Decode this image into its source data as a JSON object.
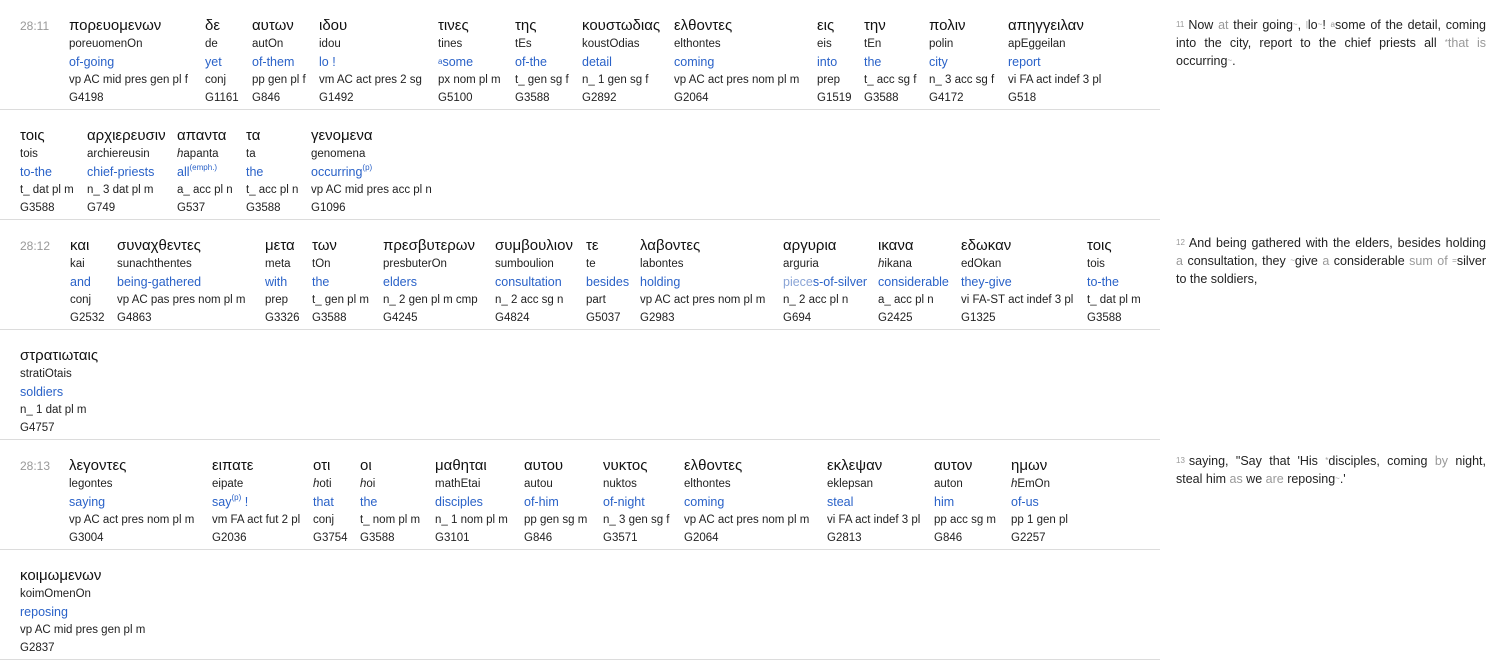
{
  "rows": [
    {
      "ref": "28:11",
      "words": [
        {
          "g": "πορευομενων",
          "tr": "poreuomenOn",
          "en": "of-going",
          "ps": "vp AC mid pres gen pl f",
          "sn": "G4198"
        },
        {
          "g": "δε",
          "tr": "de",
          "en": "yet",
          "ps": "conj",
          "sn": "G1161"
        },
        {
          "g": "αυτων",
          "tr": "autOn",
          "en": "of-them",
          "ps": "pp gen pl f",
          "sn": "G846"
        },
        {
          "g": "ιδου",
          "tr": "idou",
          "en": "lo !",
          "ps": "vm AC act pres 2 sg",
          "sn": "G1492"
        },
        {
          "g": "τινες",
          "tr": "tines",
          "en_pre": "a",
          "en": "some",
          "ps": "px nom pl m",
          "sn": "G5100"
        },
        {
          "g": "της",
          "tr": "tEs",
          "en": "of-the",
          "ps": "t_ gen sg f",
          "sn": "G3588"
        },
        {
          "g": "κουστωδιας",
          "tr": "koustOdias",
          "en": "detail",
          "ps": "n_ 1 gen sg f",
          "sn": "G2892"
        },
        {
          "g": "ελθοντες",
          "tr": "elthontes",
          "en": "coming",
          "ps": "vp AC act pres nom pl m",
          "sn": "G2064"
        },
        {
          "g": "εις",
          "tr": "eis",
          "en": "into",
          "ps": "prep",
          "sn": "G1519"
        },
        {
          "g": "την",
          "tr": "tEn",
          "en": "the",
          "ps": "t_ acc sg f",
          "sn": "G3588"
        },
        {
          "g": "πολιν",
          "tr": "polin",
          "en": "city",
          "ps": "n_ 3 acc sg f",
          "sn": "G4172"
        },
        {
          "g": "απηγγειλαν",
          "tr": "apEggeilan",
          "en": "report",
          "ps": "vi FA act indef 3 pl",
          "sn": "G518"
        }
      ]
    },
    {
      "ref": "",
      "words": [
        {
          "g": "τοις",
          "tr": "tois",
          "en": "to-the",
          "ps": "t_ dat pl m",
          "sn": "G3588"
        },
        {
          "g": "αρχιερευσιν",
          "tr": "archiereusin",
          "en": "chief-priests",
          "ps": "n_ 3 dat pl m",
          "sn": "G749"
        },
        {
          "g": "απαντα",
          "tr": "hapanta",
          "tr_i": "h",
          "tr_rest": "apanta",
          "en": "all",
          "en_sup": "(emph.)",
          "ps": "a_ acc pl n",
          "sn": "G537"
        },
        {
          "g": "τα",
          "tr": "ta",
          "en": "the",
          "ps": "t_ acc pl n",
          "sn": "G3588"
        },
        {
          "g": "γενομενα",
          "tr": "genomena",
          "en": "occurring",
          "en_sup": "(p)",
          "ps": "vp AC mid pres acc pl n",
          "sn": "G1096"
        }
      ]
    },
    {
      "ref": "28:12",
      "words": [
        {
          "g": "και",
          "tr": "kai",
          "en": "and",
          "ps": "conj",
          "sn": "G2532"
        },
        {
          "g": "συναχθεντες",
          "tr": "sunachthentes",
          "en": "being-gathered",
          "ps": "vp AC pas pres nom pl m",
          "sn": "G4863"
        },
        {
          "g": "μετα",
          "tr": "meta",
          "en": "with",
          "ps": "prep",
          "sn": "G3326"
        },
        {
          "g": "των",
          "tr": "tOn",
          "en": "the",
          "ps": "t_ gen pl m",
          "sn": "G3588"
        },
        {
          "g": "πρεσβυτερων",
          "tr": "presbuterOn",
          "en": "elders",
          "ps": "n_ 2 gen pl m cmp",
          "sn": "G4245"
        },
        {
          "g": "συμβουλιον",
          "tr": "sumboulion",
          "en": "consultation",
          "ps": "n_ 2 acc sg n",
          "sn": "G4824"
        },
        {
          "g": "τε",
          "tr": "te",
          "en": "besides",
          "ps": "part",
          "sn": "G5037"
        },
        {
          "g": "λαβοντες",
          "tr": "labontes",
          "en": "holding",
          "ps": "vp AC act pres nom pl m",
          "sn": "G2983"
        },
        {
          "g": "αργυρια",
          "tr": "arguria",
          "en_a": "piece",
          "en_b": "s-of-silver",
          "ps": "n_ 2 acc pl n",
          "sn": "G694"
        },
        {
          "g": "ικανα",
          "tr": "hikana",
          "tr_i": "h",
          "tr_rest": "ikana",
          "en": "considerable",
          "ps": "a_ acc pl n",
          "sn": "G2425"
        },
        {
          "g": "εδωκαν",
          "tr": "edOkan",
          "en": "they-give",
          "ps": "vi FA-ST act indef 3 pl",
          "sn": "G1325"
        },
        {
          "g": "τοις",
          "tr": "tois",
          "en": "to-the",
          "ps": "t_ dat pl m",
          "sn": "G3588"
        }
      ]
    },
    {
      "ref": "",
      "words": [
        {
          "g": "στρατιωταις",
          "tr": "stratiOtais",
          "en": "soldiers",
          "ps": "n_ 1 dat pl m",
          "sn": "G4757"
        }
      ]
    },
    {
      "ref": "28:13",
      "words": [
        {
          "g": "λεγοντες",
          "tr": "legontes",
          "en": "saying",
          "ps": "vp AC act pres nom pl m",
          "sn": "G3004"
        },
        {
          "g": "ειπατε",
          "tr": "eipate",
          "en": "say",
          "en_sup": "(p)",
          "en_post": " !",
          "ps": "vm FA act fut 2 pl",
          "sn": "G2036"
        },
        {
          "g": "οτι",
          "tr": "hoti",
          "tr_i": "h",
          "tr_rest": "oti",
          "en": "that",
          "ps": "conj",
          "sn": "G3754"
        },
        {
          "g": "οι",
          "tr": "hoi",
          "tr_i": "h",
          "tr_rest": "oi",
          "en": "the",
          "ps": "t_ nom pl m",
          "sn": "G3588"
        },
        {
          "g": "μαθηται",
          "tr": "mathEtai",
          "en": "disciples",
          "ps": "n_ 1 nom pl m",
          "sn": "G3101"
        },
        {
          "g": "αυτου",
          "tr": "autou",
          "en": "of-him",
          "ps": "pp gen sg m",
          "sn": "G846"
        },
        {
          "g": "νυκτος",
          "tr": "nuktos",
          "en": "of-night",
          "ps": "n_ 3 gen sg f",
          "sn": "G3571"
        },
        {
          "g": "ελθοντες",
          "tr": "elthontes",
          "en": "coming",
          "ps": "vp AC act pres nom pl m",
          "sn": "G2064"
        },
        {
          "g": "εκλεψαν",
          "tr": "eklepsan",
          "en": "steal",
          "ps": "vi FA act indef 3 pl",
          "sn": "G2813"
        },
        {
          "g": "αυτον",
          "tr": "auton",
          "en": "him",
          "ps": "pp acc sg m",
          "sn": "G846"
        },
        {
          "g": "ημων",
          "tr": "hEmOn",
          "tr_i": "h",
          "tr_rest": "EmOn",
          "en": "of-us",
          "ps": "pp 1 gen pl",
          "sn": "G2257"
        }
      ]
    },
    {
      "ref": "",
      "words": [
        {
          "g": "κοιμωμενων",
          "tr": "koimOmenOn",
          "en": "reposing",
          "ps": "vp AC mid pres gen pl m",
          "sn": "G2837"
        }
      ]
    }
  ],
  "translation": [
    {
      "num": "11",
      "parts": [
        {
          "t": "Now "
        },
        {
          "t": "at",
          "gray": true
        },
        {
          "t": " their going"
        },
        {
          "t": "~",
          "mk": true
        },
        {
          "t": ", "
        },
        {
          "t": "|",
          "mk": true
        },
        {
          "t": "lo"
        },
        {
          "t": "~",
          "mk": true
        },
        {
          "t": "! "
        },
        {
          "t": "a",
          "mk": true
        },
        {
          "t": "some of the detail, coming into the city, report to the chief priests all "
        },
        {
          "t": "*",
          "mk": true
        },
        {
          "t": "that is",
          "gray": true
        },
        {
          "t": " occurring"
        },
        {
          "t": "~",
          "mk": true
        },
        {
          "t": "."
        }
      ]
    },
    {
      "num": "12",
      "parts": [
        {
          "t": "And being gathered with the elders, besides holding "
        },
        {
          "t": "a",
          "gray": true
        },
        {
          "t": " consultation, they "
        },
        {
          "t": "~",
          "mk": true
        },
        {
          "t": "give "
        },
        {
          "t": "a",
          "gray": true
        },
        {
          "t": " considerable "
        },
        {
          "t": "sum of",
          "gray": true
        },
        {
          "t": " "
        },
        {
          "t": "=",
          "mk": true
        },
        {
          "t": "silver to the soldiers,"
        }
      ]
    },
    {
      "num": "13",
      "parts": [
        {
          "t": "saying, \"Say that 'His "
        },
        {
          "t": "*",
          "mk": true
        },
        {
          "t": "disciples, coming "
        },
        {
          "t": "by",
          "gray": true
        },
        {
          "t": " night, steal him "
        },
        {
          "t": "as",
          "gray": true
        },
        {
          "t": " we "
        },
        {
          "t": "are",
          "gray": true
        },
        {
          "t": " reposing"
        },
        {
          "t": "~",
          "mk": true
        },
        {
          "t": ".'"
        }
      ]
    }
  ]
}
